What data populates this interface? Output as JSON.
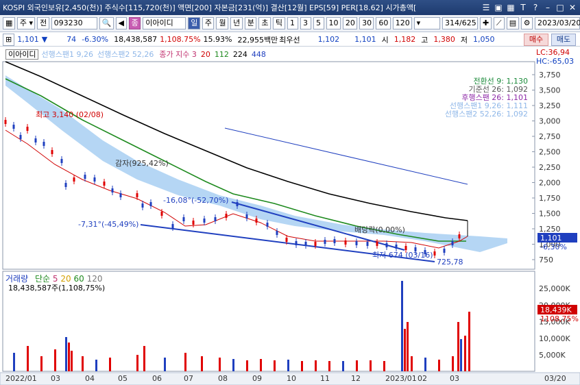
{
  "window": {
    "title": "KOSPI 외국인보유[2,450(천)] 주식수[115,720(천)] 액면[200] 자본금[231(억)] 결산[12월] EPS[59] PER[18.62] 시가총액[",
    "icons": [
      "list-icon",
      "restore-icon",
      "tile-icon",
      "text-icon",
      "help-icon",
      "minimize-icon",
      "maximize-icon",
      "close-icon"
    ]
  },
  "toolbar": {
    "type_select": "주",
    "prev_label": "전",
    "code": "093230",
    "name_label": "이아이디",
    "name_prefix": "종",
    "periods": [
      "일",
      "주",
      "월",
      "년",
      "분",
      "초",
      "틱"
    ],
    "selected_period": "일",
    "minutes": [
      "1",
      "3",
      "5",
      "10",
      "20",
      "30",
      "60",
      "120"
    ],
    "page": "314/625",
    "date": "2023/03/20",
    "buy_label": "매수",
    "sell_label": "매도"
  },
  "pricebar": {
    "price": "1,101",
    "change_arrow": "▼",
    "change": "74",
    "change_pct": "-6.30%",
    "volume": "18,438,587",
    "volume_pct": "1,108.75%",
    "turnover": "15.93%",
    "amount": "22,955백만",
    "best_bid_label": "최우선",
    "bid": "1,102",
    "ask": "1,101",
    "open_label": "시",
    "open": "1,182",
    "high_label": "고",
    "high": "1,380",
    "low_label": "저",
    "low": "1,050"
  },
  "legend": {
    "name": "이아이디",
    "span1": "선행스팬1 9,26",
    "span2": "선행스팬2 52,26",
    "ma_label": "종가 지수 3",
    "ma_periods": [
      "20",
      "112",
      "224",
      "448"
    ],
    "lc": "LC:36,94",
    "hc": "HC:-65,03"
  },
  "ichimoku_legend": [
    {
      "text": "전환선 9: 1,130",
      "color": "#1b8a3a"
    },
    {
      "text": "기준선 26: 1,092",
      "color": "#555555"
    },
    {
      "text": "후행스팬 26: 1,101",
      "color": "#8e2aa8"
    },
    {
      "text": "선행스팬1 9,26: 1,111",
      "color": "#8fb7e8"
    },
    {
      "text": "선행스팬2 52,26: 1,092",
      "color": "#8fb7e8"
    }
  ],
  "annotations": {
    "max": "최고 3,140 (02/08)",
    "reduction": "감자(925,42%)",
    "trend1": "-16,08°(-52,70%)",
    "trend2": "-7,31°(-45,49%)",
    "dividend": "배당락(0,00%)",
    "min": "최저 674 (03/16)",
    "min_extra": "725,78"
  },
  "price_axis": [
    "3,750",
    "3,500",
    "3,250",
    "3,000",
    "2,750",
    "2,500",
    "2,250",
    "2,000",
    "1,750",
    "1,500",
    "1,250",
    "1,000",
    "750"
  ],
  "current_price_tag": "1,101",
  "current_pct_tag": "-6,30%",
  "volume_legend": {
    "label": "거래량",
    "ma_label": "단순",
    "ma_periods": [
      "5",
      "20",
      "60",
      "120"
    ],
    "value": "18,438,587주(1,108,75%)"
  },
  "volume_axis": [
    "25,000K",
    "20,000K",
    "15,000K",
    "10,000K",
    "5,000K"
  ],
  "volume_tag": "18,439K",
  "volume_pct_tag": "1108,75%",
  "x_axis": [
    "2022/01",
    "03",
    "04",
    "05",
    "06",
    "07",
    "08",
    "09",
    "10",
    "11",
    "12",
    "2023/01",
    "02",
    "03"
  ],
  "x_axis_right": "03/20",
  "colors": {
    "up": "#e00000",
    "down": "#1f3fbf",
    "cloud": "#9cc8f0",
    "ma_black": "#000000",
    "ma_green": "#1e8a1e",
    "ma_red": "#d00000"
  }
}
